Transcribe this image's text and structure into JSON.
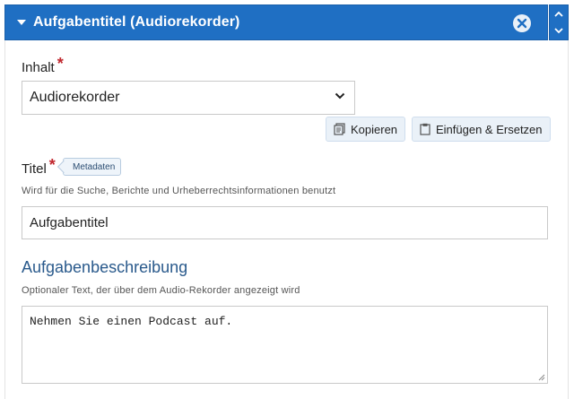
{
  "header": {
    "title": "Aufgabentitel (Audiorekorder)"
  },
  "content": {
    "label": "Inhalt",
    "required_mark": "*",
    "selected_value": "Audiorekorder",
    "copy_label": "Kopieren",
    "paste_label": "Einfügen & Ersetzen"
  },
  "title_field": {
    "label": "Titel",
    "required_mark": "*",
    "badge": "Metadaten",
    "help": "Wird für die Suche, Berichte und Urheberrechtsinformationen benutzt",
    "value": "Aufgabentitel"
  },
  "description": {
    "label": "Aufgabenbeschreibung",
    "help": "Optionaler Text, der über dem Audio-Rekorder angezeigt wird",
    "value": "Nehmen Sie einen Podcast auf."
  },
  "colors": {
    "header": "#1f6fc3",
    "required": "#c0262d",
    "section_title": "#2a5a8c"
  },
  "icons": [
    "caret-down-icon",
    "close-icon",
    "chevron-up-icon",
    "chevron-down-icon",
    "copy-icon",
    "paste-icon",
    "resize-grip-icon"
  ]
}
